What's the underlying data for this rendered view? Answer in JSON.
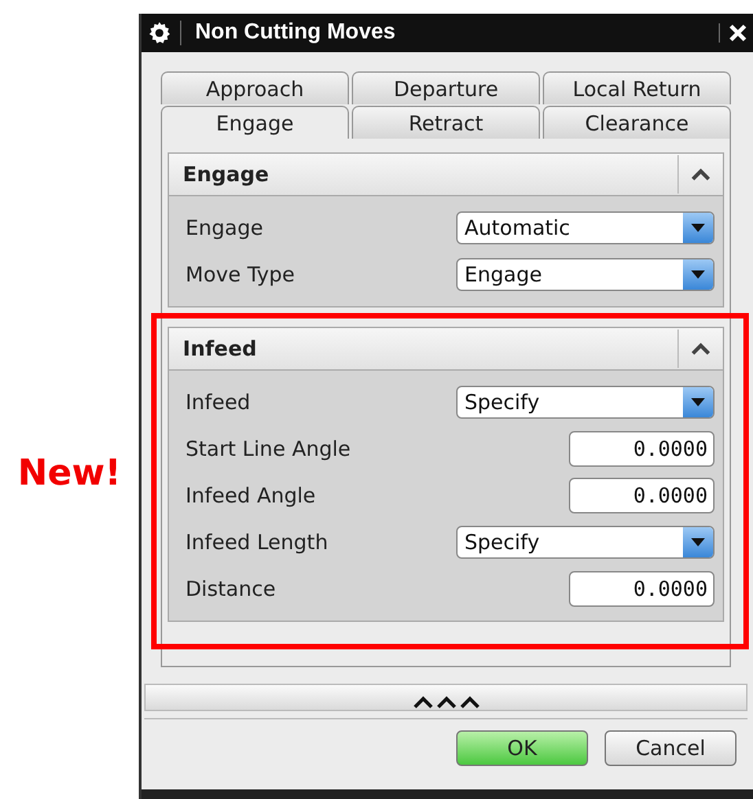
{
  "annotation": {
    "label": "New!"
  },
  "window": {
    "title": "Non Cutting Moves"
  },
  "tabs": [
    [
      {
        "label": "Approach",
        "selected": false
      },
      {
        "label": "Departure",
        "selected": false
      },
      {
        "label": "Local Return",
        "selected": false
      }
    ],
    [
      {
        "label": "Engage",
        "selected": true
      },
      {
        "label": "Retract",
        "selected": false
      },
      {
        "label": "Clearance",
        "selected": false
      }
    ]
  ],
  "sections": [
    {
      "title": "Engage",
      "expanded": true,
      "highlighted": false,
      "rows": [
        {
          "kind": "select",
          "label": "Engage",
          "value": "Automatic"
        },
        {
          "kind": "select",
          "label": "Move Type",
          "value": "Engage"
        }
      ]
    },
    {
      "title": "Infeed",
      "expanded": true,
      "highlighted": true,
      "rows": [
        {
          "kind": "select",
          "label": "Infeed",
          "value": "Specify"
        },
        {
          "kind": "number",
          "label": "Start Line Angle",
          "value": "0.0000"
        },
        {
          "kind": "number",
          "label": "Infeed Angle",
          "value": "0.0000"
        },
        {
          "kind": "select",
          "label": "Infeed Length",
          "value": "Specify"
        },
        {
          "kind": "number",
          "label": "Distance",
          "value": "0.0000"
        }
      ]
    }
  ],
  "buttons": [
    {
      "label": "OK",
      "default": true
    },
    {
      "label": "Cancel",
      "default": false
    }
  ]
}
